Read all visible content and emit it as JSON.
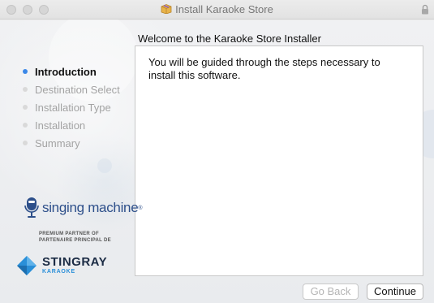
{
  "window": {
    "title": "Install Karaoke Store"
  },
  "header": {
    "welcome": "Welcome to the Karaoke Store Installer"
  },
  "content": {
    "message": "You will be guided through the steps necessary to install this software."
  },
  "sidebar": {
    "steps": [
      {
        "label": "Introduction",
        "active": true
      },
      {
        "label": "Destination Select",
        "active": false
      },
      {
        "label": "Installation Type",
        "active": false
      },
      {
        "label": "Installation",
        "active": false
      },
      {
        "label": "Summary",
        "active": false
      }
    ]
  },
  "branding": {
    "singing_machine": "singing machine",
    "trademark": "®",
    "partner_line1": "PREMIUM PARTNER OF",
    "partner_line2": "PARTENAIRE PRINCIPAL DE",
    "stingray": "STINGRAY",
    "stingray_sub": "KARAOKE"
  },
  "buttons": {
    "back": "Go Back",
    "continue": "Continue"
  },
  "colors": {
    "active_step_dot": "#3b88e8",
    "inactive_step_dot": "#d9d9d9",
    "brand_blue": "#2d4f8a",
    "stingray_accent": "#2a8fd8"
  }
}
